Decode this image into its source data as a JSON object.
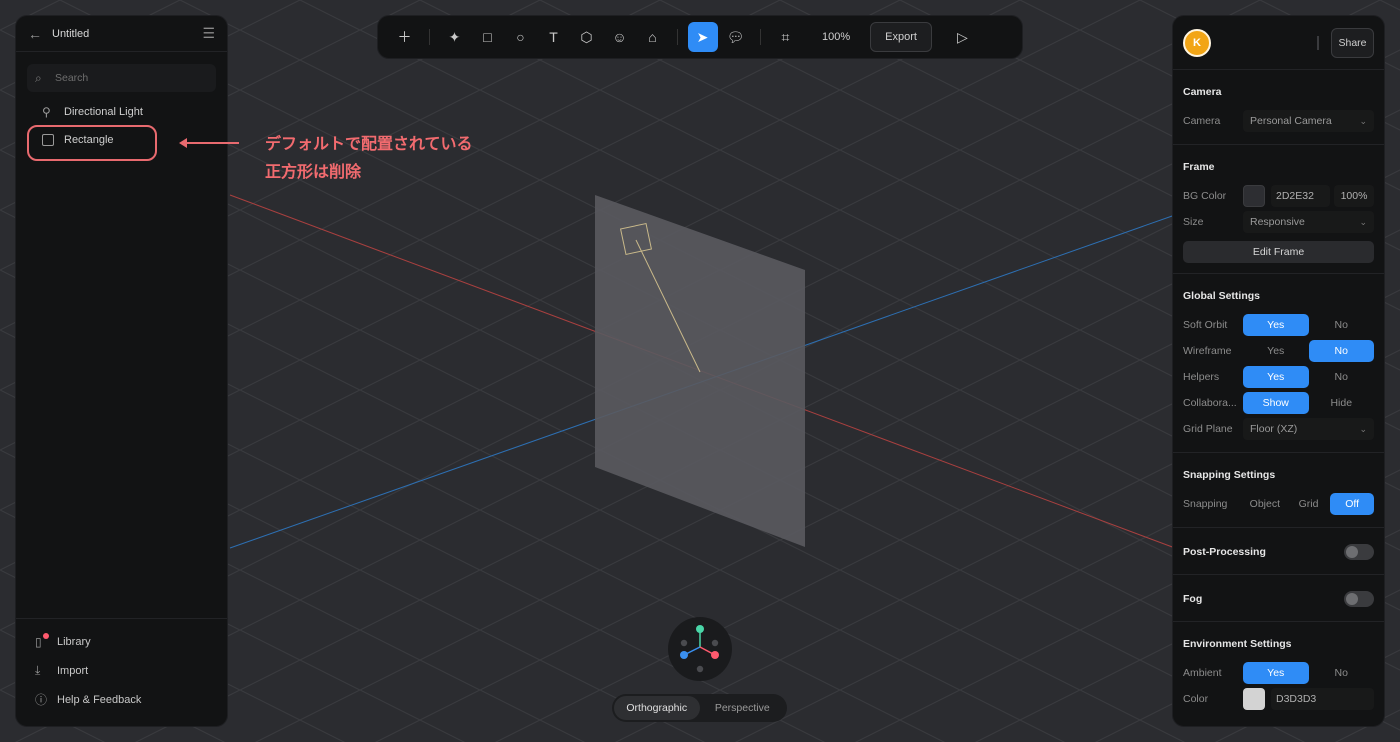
{
  "left_panel": {
    "title": "Untitled",
    "search_placeholder": "Search",
    "layers": [
      {
        "label": "Directional Light",
        "icon": "light-icon"
      },
      {
        "label": "Rectangle",
        "icon": "rectangle-icon"
      }
    ],
    "footer": [
      {
        "label": "Library",
        "icon": "library-icon"
      },
      {
        "label": "Import",
        "icon": "import-icon"
      },
      {
        "label": "Help & Feedback",
        "icon": "help-icon"
      }
    ]
  },
  "annotation": {
    "line1": "デフォルトで配置されている",
    "line2": "正方形は削除",
    "color": "#e86a6f"
  },
  "toolbar": {
    "zoom": "100%",
    "export_label": "Export",
    "active_tool": "select",
    "accent": "#2f8cf6"
  },
  "right_panel": {
    "avatar_letter": "K",
    "share_label": "Share",
    "camera": {
      "title": "Camera",
      "label": "Camera",
      "value": "Personal Camera"
    },
    "frame": {
      "title": "Frame",
      "bg_label": "BG Color",
      "bg_hex": "2D2E32",
      "bg_opacity": "100%",
      "size_label": "Size",
      "size_value": "Responsive",
      "edit_label": "Edit Frame"
    },
    "global": {
      "title": "Global Settings",
      "soft_orbit": {
        "label": "Soft Orbit",
        "yes": "Yes",
        "no": "No"
      },
      "wireframe": {
        "label": "Wireframe",
        "yes": "Yes",
        "no": "No"
      },
      "helpers": {
        "label": "Helpers",
        "yes": "Yes",
        "no": "No"
      },
      "collab": {
        "label": "Collabora...",
        "show": "Show",
        "hide": "Hide"
      },
      "grid_plane": {
        "label": "Grid Plane",
        "value": "Floor (XZ)"
      }
    },
    "snapping": {
      "title": "Snapping Settings",
      "label": "Snapping",
      "object": "Object",
      "grid": "Grid",
      "off": "Off"
    },
    "post": {
      "title": "Post-Processing"
    },
    "fog": {
      "title": "Fog"
    },
    "env": {
      "title": "Environment Settings",
      "ambient_label": "Ambient",
      "yes": "Yes",
      "no": "No",
      "color_label": "Color",
      "color_hex": "D3D3D3"
    }
  },
  "view_switch": {
    "ortho": "Orthographic",
    "persp": "Perspective"
  }
}
